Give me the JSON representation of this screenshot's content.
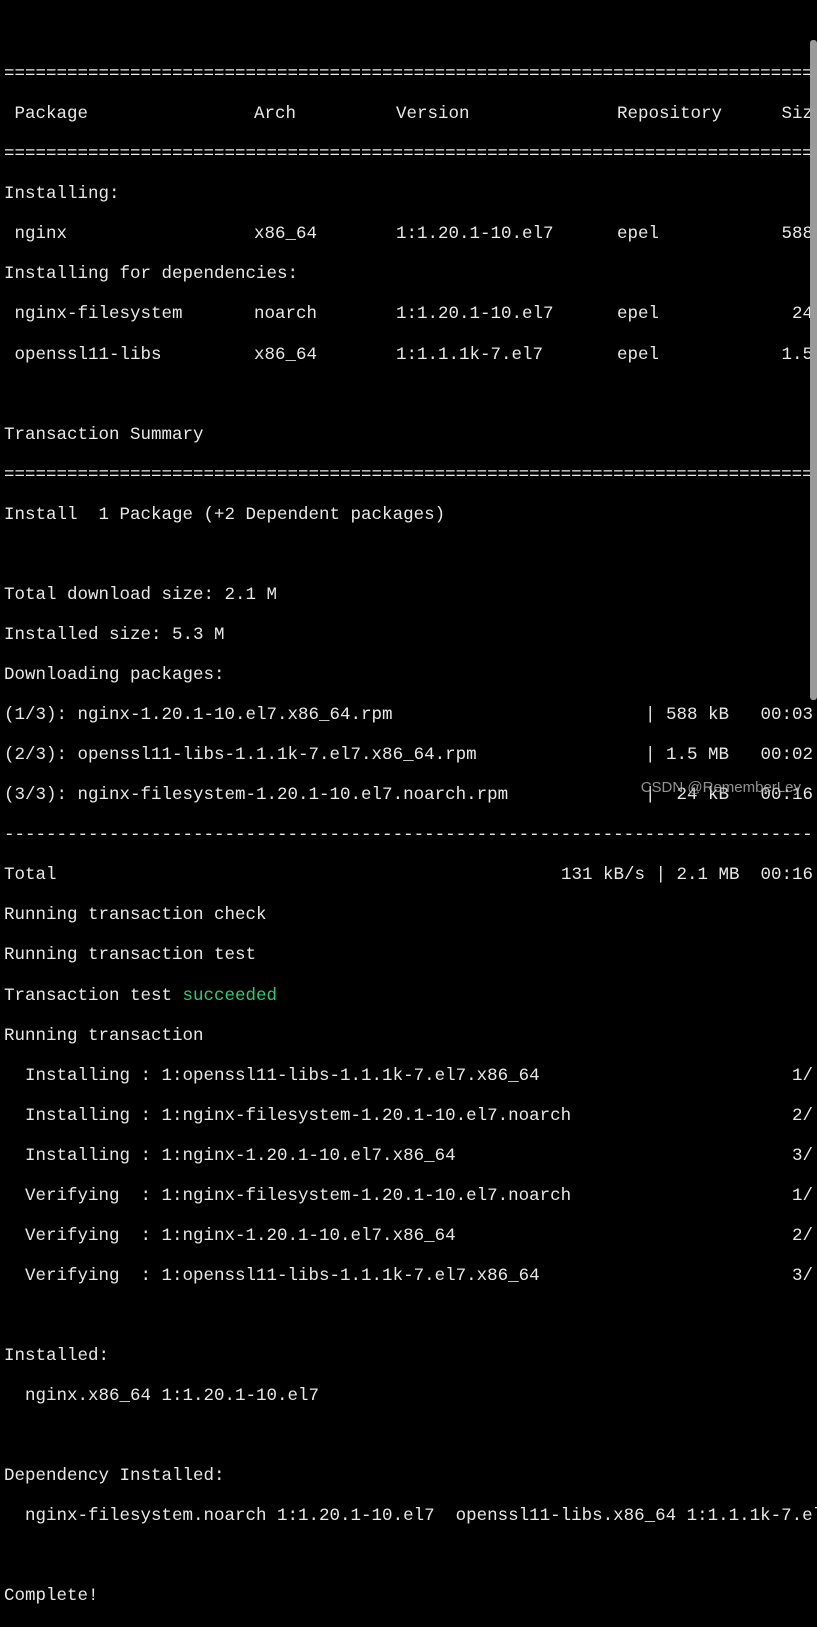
{
  "divider_eq": "=================================================================================",
  "divider_dash": "---------------------------------------------------------------------------------",
  "headers": {
    "package": " Package",
    "arch": "Arch",
    "version": "Version",
    "repository": "Repository",
    "size": "Siz"
  },
  "sections": {
    "installing": "Installing:",
    "installing_deps": "Installing for dependencies:",
    "tx_summary": "Transaction Summary",
    "install_line": "Install  1 Package (+2 Dependent packages)",
    "dl_size": "Total download size: 2.1 M",
    "inst_size": "Installed size: 5.3 M",
    "dl_pkgs": "Downloading packages:",
    "running_check": "Running transaction check",
    "running_test": "Running transaction test",
    "tx_test_label": "Transaction test ",
    "tx_test_status": "succeeded",
    "running_tx": "Running transaction",
    "installed": "Installed:",
    "dep_installed": "Dependency Installed:",
    "complete": "Complete!"
  },
  "packages": {
    "nginx": {
      "name": " nginx",
      "arch": "x86_64",
      "ver": "1:1.20.1-10.el7",
      "repo": "epel",
      "size": "588"
    },
    "nginx_fs": {
      "name": " nginx-filesystem",
      "arch": "noarch",
      "ver": "1:1.20.1-10.el7",
      "repo": "epel",
      "size": "24"
    },
    "openssl11": {
      "name": " openssl11-libs",
      "arch": "x86_64",
      "ver": "1:1.1.1k-7.el7",
      "repo": "epel",
      "size": "1.5"
    }
  },
  "downloads": {
    "d1": {
      "left": "(1/3): nginx-1.20.1-10.el7.x86_64.rpm",
      "right": "| 588 kB   00:03"
    },
    "d2": {
      "left": "(2/3): openssl11-libs-1.1.1k-7.el7.x86_64.rpm",
      "right": "| 1.5 MB   00:02"
    },
    "d3": {
      "left": "(3/3): nginx-filesystem-1.20.1-10.el7.noarch.rpm",
      "right": "|  24 kB   00:16"
    }
  },
  "total": {
    "left": "Total",
    "right": "131 kB/s | 2.1 MB  00:16"
  },
  "tx_steps": {
    "s1": {
      "left": "  Installing : 1:openssl11-libs-1.1.1k-7.el7.x86_64",
      "right": "1/"
    },
    "s2": {
      "left": "  Installing : 1:nginx-filesystem-1.20.1-10.el7.noarch",
      "right": "2/"
    },
    "s3": {
      "left": "  Installing : 1:nginx-1.20.1-10.el7.x86_64",
      "right": "3/"
    },
    "s4": {
      "left": "  Verifying  : 1:nginx-filesystem-1.20.1-10.el7.noarch",
      "right": "1/"
    },
    "s5": {
      "left": "  Verifying  : 1:nginx-1.20.1-10.el7.x86_64",
      "right": "2/"
    },
    "s6": {
      "left": "  Verifying  : 1:openssl11-libs-1.1.1k-7.el7.x86_64",
      "right": "3/"
    }
  },
  "installed_line": "  nginx.x86_64 1:1.20.1-10.el7",
  "dep_installed_line": "  nginx-filesystem.noarch 1:1.20.1-10.el7  openssl11-libs.x86_64 1:1.1.1k-7.el",
  "watermark": "CSDN @RememberLey"
}
